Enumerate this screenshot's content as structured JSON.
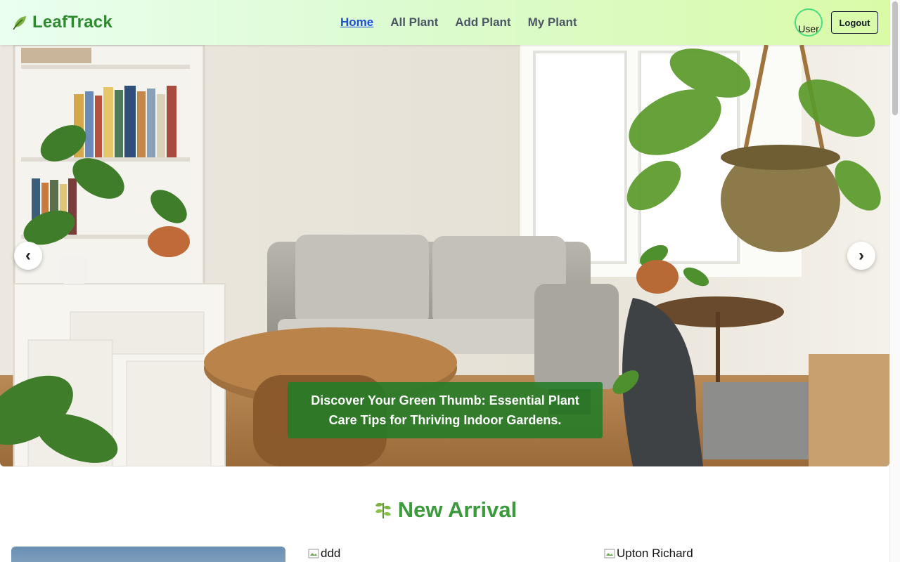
{
  "navbar": {
    "brand": "LeafTrack",
    "brand_icon": "leaf-icon",
    "links": [
      {
        "label": "Home",
        "active": true
      },
      {
        "label": "All Plant",
        "active": false
      },
      {
        "label": "Add Plant",
        "active": false
      },
      {
        "label": "My Plant",
        "active": false
      }
    ],
    "avatar_alt": "User",
    "logout_label": "Logout"
  },
  "hero": {
    "caption": "Discover Your Green Thumb: Essential Plant Care Tips for Thriving Indoor Gardens.",
    "prev_label": "‹",
    "next_label": "›"
  },
  "new_arrival": {
    "title": "New Arrival",
    "title_icon": "leaf-icon",
    "cards": [
      {
        "alt": ""
      },
      {
        "alt": "ddd"
      },
      {
        "alt": "Upton Richard"
      }
    ]
  },
  "colors": {
    "brand_green": "#2f8a2f",
    "active_link": "#1d4ed8",
    "caption_bg": "#227c28",
    "section_title": "#3b9a3b"
  }
}
